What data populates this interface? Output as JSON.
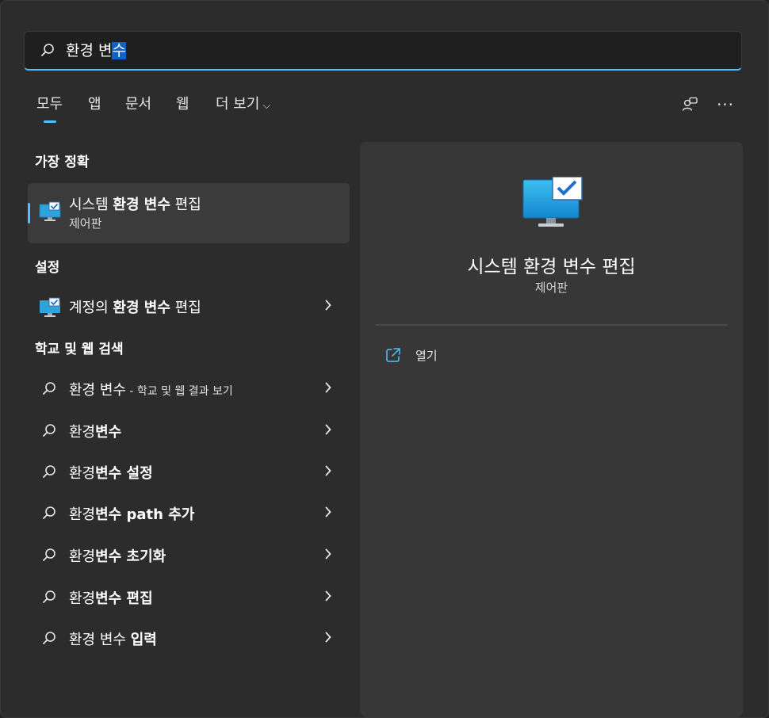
{
  "search": {
    "query_prefix": "환경 변",
    "query_selected": "수"
  },
  "tabs": [
    {
      "label": "모두",
      "active": true
    },
    {
      "label": "앱"
    },
    {
      "label": "문서"
    },
    {
      "label": "웹"
    },
    {
      "label": "더 보기",
      "chevron": "⌵"
    }
  ],
  "toolbar": {
    "account_icon": "people-chat-icon",
    "more_glyph": "···"
  },
  "sections": {
    "best_match": "가장 정확",
    "settings": "설정",
    "web": "학교 및 웹 검색"
  },
  "best_match": {
    "title_pre": "시스템 ",
    "title_bold": "환경 변수",
    "title_post": " 편집",
    "subtitle": "제어판"
  },
  "settings_item": {
    "pre": "계정의 ",
    "bold": "환경 변수",
    "post": " 편집"
  },
  "web_results": [
    {
      "pre": "환경 변수",
      "bold": "",
      "small": " - 학교 및 웹 결과 보기"
    },
    {
      "pre": "환경",
      "bold": "변수",
      "small": ""
    },
    {
      "pre": "환경",
      "bold": "변수 설정",
      "small": ""
    },
    {
      "pre": "환경",
      "bold": "변수 path 추가",
      "small": ""
    },
    {
      "pre": "환경",
      "bold": "변수 초기화",
      "small": ""
    },
    {
      "pre": "환경",
      "bold": "변수 편집",
      "small": ""
    },
    {
      "pre": "환경 변수 ",
      "bold": "입력",
      "small": ""
    }
  ],
  "preview": {
    "title": "시스템 환경 변수 편집",
    "subtitle": "제어판",
    "action_label": "열기"
  },
  "colors": {
    "accent": "#4cc2ff",
    "selection": "#0a64c8",
    "panel": "#373737",
    "background": "#2c2c2c"
  }
}
